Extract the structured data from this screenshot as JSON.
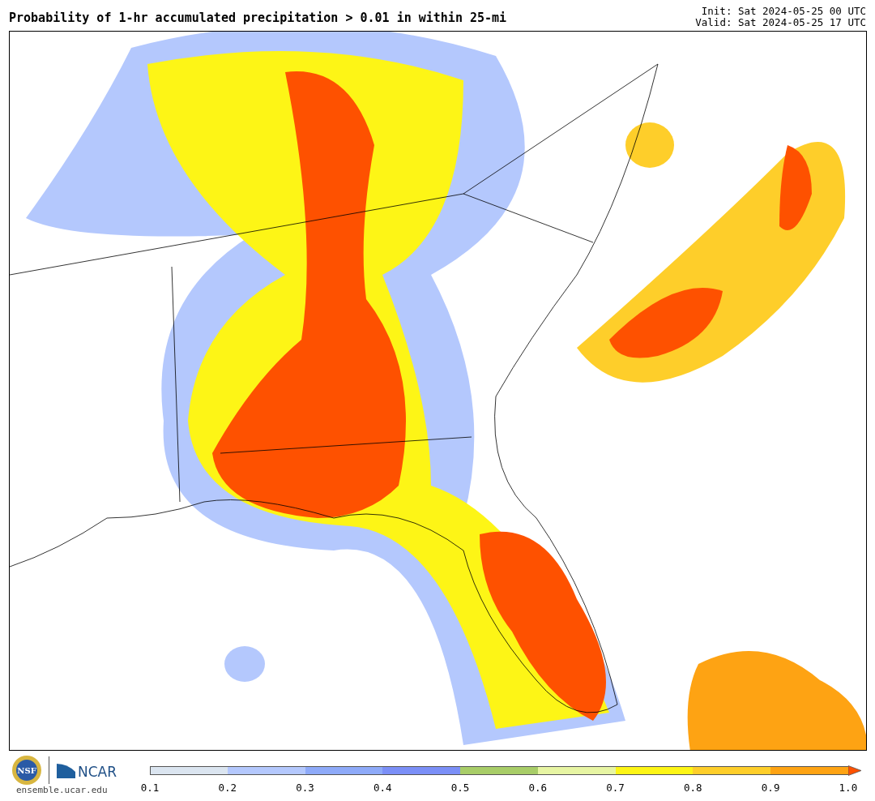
{
  "title": "Probability of 1-hr accumulated precipitation > 0.01 in within 25-mi",
  "init": "Init: Sat 2024-05-25 00 UTC",
  "valid": "Valid: Sat 2024-05-25 17 UTC",
  "logos": {
    "nsf": "NSF",
    "ncar": "NCAR",
    "site": "ensemble.ucar.edu"
  },
  "legend": {
    "bins": [
      {
        "color": "#dbe5f0"
      },
      {
        "color": "#b4c8fd"
      },
      {
        "color": "#8eaaf9"
      },
      {
        "color": "#7b8ff7"
      },
      {
        "color": "#a8cd68"
      },
      {
        "color": "#e7f5a3"
      },
      {
        "color": "#fdf516"
      },
      {
        "color": "#fece2a"
      },
      {
        "color": "#fea313"
      }
    ],
    "overflow_bin": {
      "color": "#fe5100"
    },
    "ticks": [
      "0.1",
      "0.2",
      "0.3",
      "0.4",
      "0.5",
      "0.6",
      "0.7",
      "0.8",
      "0.9",
      "1.0"
    ]
  }
}
